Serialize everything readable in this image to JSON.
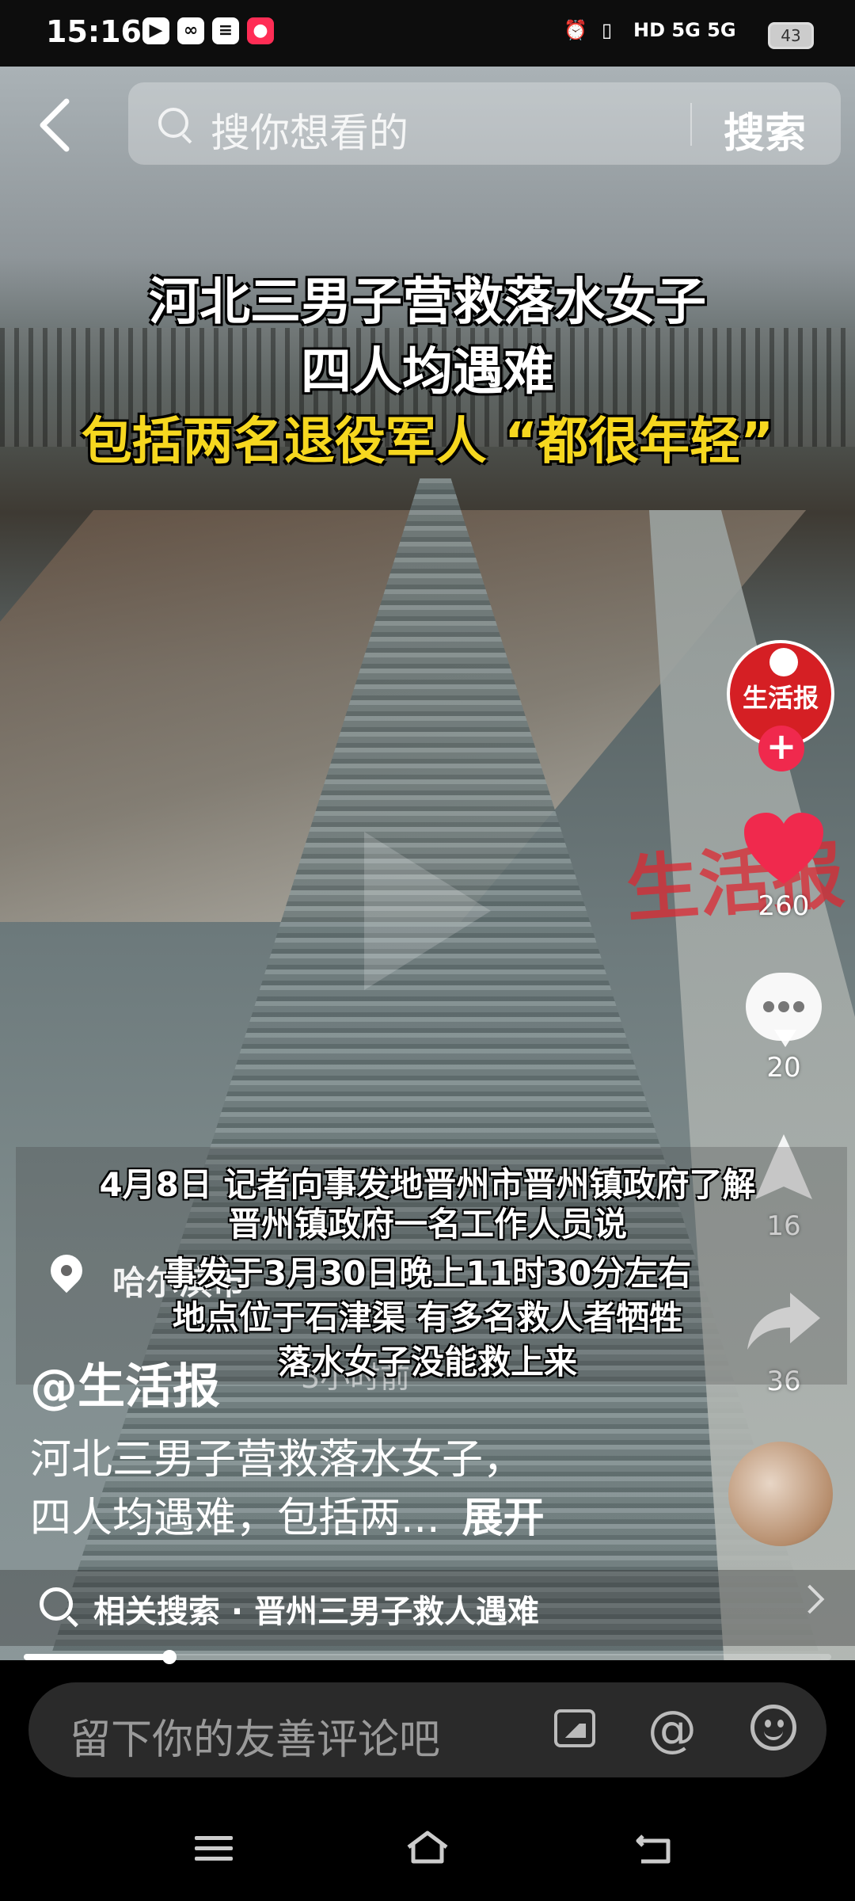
{
  "status_bar": {
    "time": "15:16",
    "network": "HD 5G 5G",
    "battery": "43"
  },
  "search": {
    "placeholder": "搜你想看的",
    "button_label": "搜索"
  },
  "video": {
    "headline": [
      "河北三男子营救落水女子",
      "四人均遇难",
      "包括两名退役军人 “都很年轻”"
    ],
    "subtitles": [
      "4月8日 记者向事发地晋州市晋州镇政府了解",
      "晋州镇政府一名工作人员说",
      "事发于3月30日晚上11时30分左右",
      "地点位于石津渠 有多名救人者牺牲",
      "落水女子没能救上来"
    ],
    "watermark": "生活报"
  },
  "author": {
    "avatar_text": "生活报",
    "handle": "@生活报",
    "location": "哈尔滨市",
    "time_ago": "3小时前"
  },
  "description": {
    "line1": "河北三男子营救落水女子，",
    "line2": "四人均遇难，包括两...",
    "expand_label": "展开"
  },
  "actions": {
    "likes": "260",
    "comments": "20",
    "collects": "16",
    "shares": "36"
  },
  "related_search": {
    "text": "相关搜索 · 晋州三男子救人遇难"
  },
  "progress": {
    "fraction": 0.18
  },
  "comment_input": {
    "placeholder": "留下你的友善评论吧"
  },
  "colors": {
    "accent_red": "#f0294d",
    "headline_yellow": "#f6d71f",
    "brand_red": "#d51f24"
  },
  "icons": [
    "back-arrow-icon",
    "search-icon",
    "play-icon",
    "heart-icon",
    "comment-icon",
    "collect-icon",
    "share-icon",
    "location-pin-icon",
    "image-icon",
    "at-icon",
    "emoji-icon",
    "menu-icon",
    "home-icon",
    "back-icon"
  ]
}
